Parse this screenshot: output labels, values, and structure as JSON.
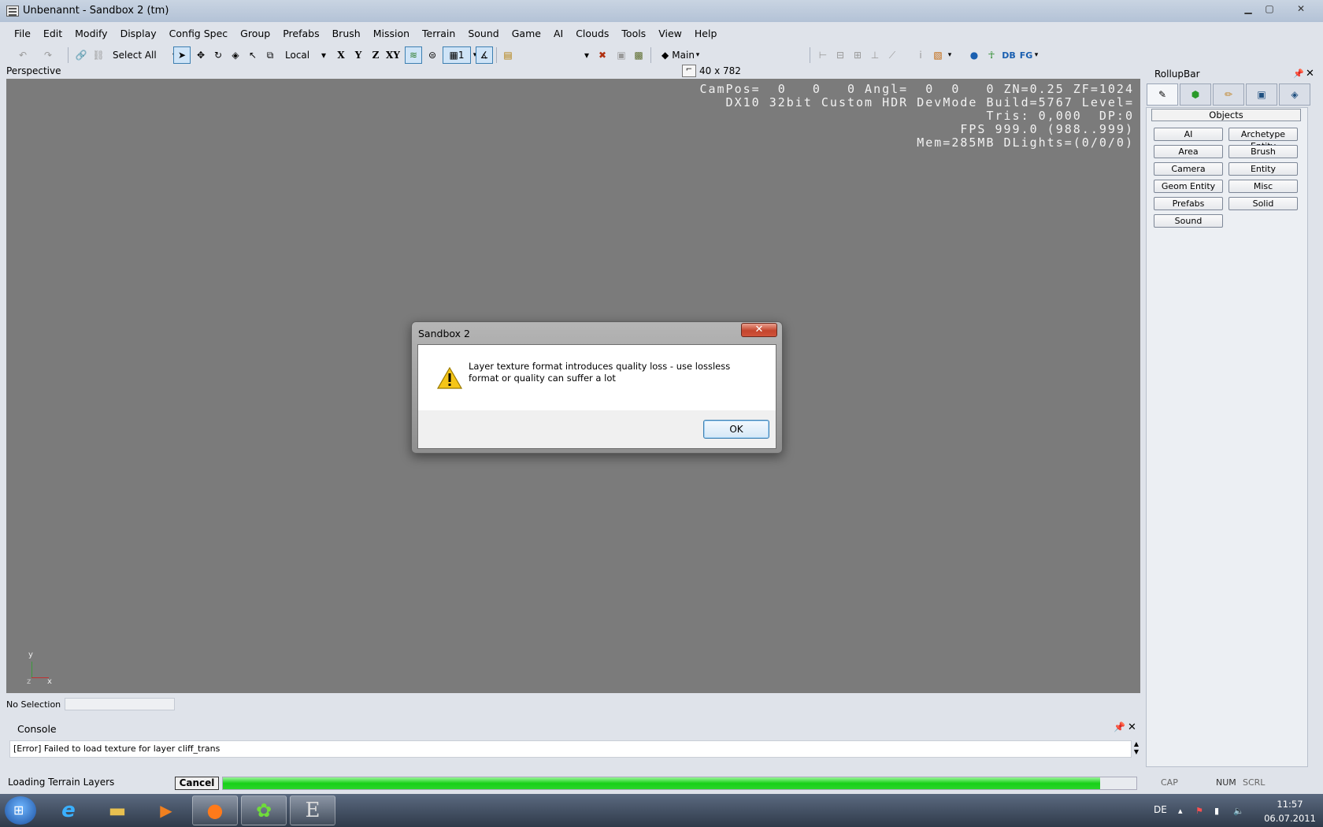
{
  "window": {
    "title": "Unbenannt - Sandbox 2 (tm)"
  },
  "menu": [
    "File",
    "Edit",
    "Modify",
    "Display",
    "Config Spec",
    "Group",
    "Prefabs",
    "Brush",
    "Mission",
    "Terrain",
    "Sound",
    "Game",
    "AI",
    "Clouds",
    "Tools",
    "View",
    "Help"
  ],
  "toolbar": {
    "select_filter": "Select All",
    "coord_system": "Local",
    "axis_x": "X",
    "axis_y": "Y",
    "axis_z": "Z",
    "axis_xy": "XY",
    "grid_value": "1",
    "layer_label": "Main",
    "db_label": "DB",
    "fg_label": "FG"
  },
  "viewport": {
    "label": "Perspective",
    "size": "40 x 782",
    "stats": [
      "CamPos=  0   0   0 Angl=  0  0   0 ZN=0.25 ZF=1024",
      "DX10 32bit Custom HDR DevMode Build=5767 Level=",
      "Tris: 0,000  DP:0",
      "FPS 999.0 (988..999)",
      "Mem=285MB DLights=(0/0/0)"
    ],
    "axis": {
      "y": "y",
      "z": "z",
      "x": "x"
    }
  },
  "selection_status": "No Selection",
  "console": {
    "title": "Console",
    "lines": [
      "[Error] Failed to load texture for layer cliff_trans"
    ]
  },
  "status_bar": {
    "text": "Loading Terrain Layers",
    "cancel_label": "Cancel",
    "progress": 0.96,
    "cap": "CAP",
    "num": "NUM",
    "scrl": "SCRL"
  },
  "rollup": {
    "title": "RollupBar",
    "section": "Objects",
    "buttons": [
      "AI",
      "Archetype Entity",
      "Area",
      "Brush",
      "Camera",
      "Entity",
      "Geom Entity",
      "Misc",
      "Prefabs",
      "Solid",
      "Sound"
    ]
  },
  "dialog": {
    "title": "Sandbox 2",
    "close_label": "✕",
    "message": "Layer texture format introduces quality loss - use lossless format or quality can suffer a lot",
    "ok_label": "OK"
  },
  "taskbar": {
    "lang": "DE",
    "time": "11:57",
    "date": "06.07.2011"
  },
  "colors": {
    "progress": "#18d018",
    "viewport_bg": "#7b7b7b",
    "close_red": "#c4452d"
  }
}
